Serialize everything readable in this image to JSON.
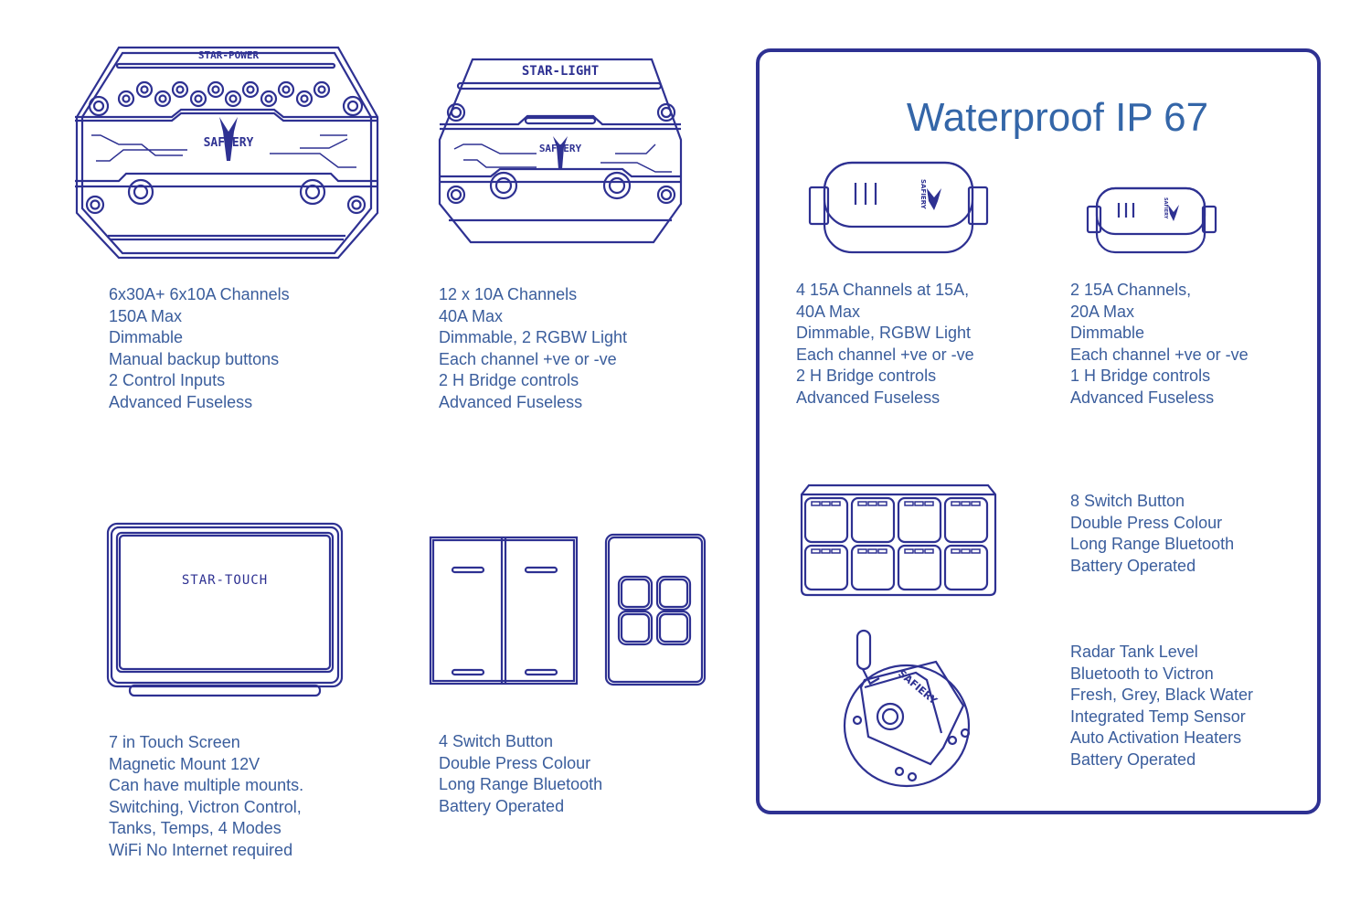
{
  "colors": {
    "text": "#3a5d9c",
    "outline": "#2e3192",
    "title": "#3466a8"
  },
  "waterproof_title": "Waterproof IP 67",
  "products": {
    "star_power": {
      "device_label": "STAR-POWER",
      "brand_label": "SAFIERY",
      "specs": [
        "6x30A+ 6x10A Channels",
        "150A Max",
        "Dimmable",
        "Manual backup buttons",
        "2 Control Inputs",
        "Advanced Fuseless"
      ]
    },
    "star_light": {
      "device_label": "STAR-LIGHT",
      "brand_label": "SAFIERY",
      "specs": [
        "12 x 10A Channels",
        "40A Max",
        "Dimmable, 2 RGBW Light",
        "Each channel +ve or -ve",
        "2 H Bridge controls",
        "Advanced Fuseless"
      ]
    },
    "star_touch": {
      "device_label": "STAR-TOUCH",
      "specs": [
        "7 in Touch Screen",
        "Magnetic Mount 12V",
        "Can have multiple mounts.",
        "Switching, Victron Control,",
        "Tanks, Temps, 4 Modes",
        "WiFi No Internet required"
      ]
    },
    "switch_4": {
      "specs": [
        "4 Switch Button",
        "Double Press Colour",
        "Long Range Bluetooth",
        "Battery Operated"
      ]
    },
    "waterproof_4ch": {
      "brand_label": "SAFIERY",
      "specs": [
        "4 15A Channels at 15A,",
        "40A Max",
        "Dimmable, RGBW Light",
        "Each channel +ve or -ve",
        "2 H Bridge controls",
        "Advanced Fuseless"
      ]
    },
    "waterproof_2ch": {
      "brand_label": "SAFIERY",
      "specs": [
        "2 15A Channels,",
        "20A Max",
        "Dimmable",
        "Each channel +ve or -ve",
        "1 H Bridge controls",
        "Advanced Fuseless"
      ]
    },
    "switch_8": {
      "specs": [
        "8 Switch Button",
        "Double Press Colour",
        "Long Range Bluetooth",
        "Battery Operated"
      ]
    },
    "tank_sensor": {
      "brand_label": "SAFIERY",
      "specs": [
        "Radar Tank Level",
        "Bluetooth to Victron",
        "Fresh, Grey, Black Water",
        "Integrated Temp Sensor",
        "Auto Activation Heaters",
        "Battery Operated"
      ]
    }
  }
}
